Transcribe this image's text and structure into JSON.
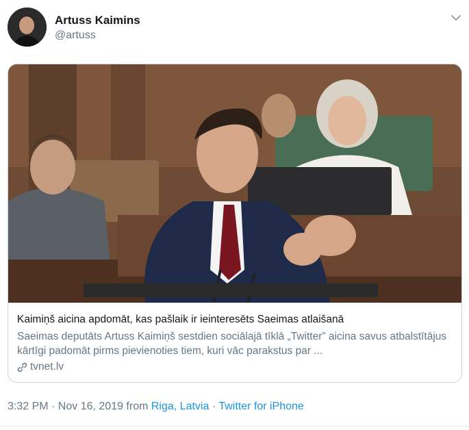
{
  "user": {
    "name": "Artuss Kaimins",
    "handle": "@artuss"
  },
  "card": {
    "title": "Kaimiņš aicina apdomāt, kas pašlaik ir ieinteresēts Saeimas atlaišanā",
    "description": "Saeimas deputāts Artuss Kaimiņš sestdien sociālajā tīklā „Twitter” aicina savus atbalstītājus kārtīgi padomāt pirms pievienoties tiem, kuri vāc parakstus par ...",
    "domain": "tvnet.lv"
  },
  "meta": {
    "time": "3:32 PM · Nov 16, 2019 from ",
    "location": "Riga, Latvia",
    "separator": " · ",
    "source": "Twitter for iPhone"
  },
  "icons": {
    "caret": "chevron-down-icon",
    "link": "link-icon"
  },
  "colors": {
    "link": "#1b95e0",
    "secondary_text": "#657786",
    "border": "#ccd6dd"
  }
}
